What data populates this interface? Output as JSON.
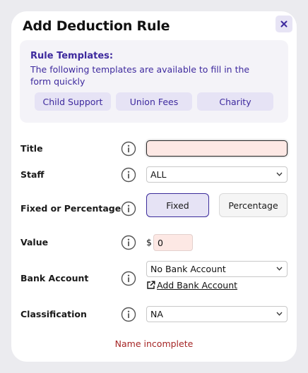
{
  "modal": {
    "title": "Add Deduction Rule",
    "close_icon": "close-icon"
  },
  "templates": {
    "heading": "Rule Templates:",
    "description": "The following templates are available to fill in the form quickly",
    "buttons": [
      "Child Support",
      "Union Fees",
      "Charity"
    ]
  },
  "form": {
    "title": {
      "label": "Title",
      "value": ""
    },
    "staff": {
      "label": "Staff",
      "selected": "ALL"
    },
    "type": {
      "label": "Fixed or Percentage",
      "options": [
        "Fixed",
        "Percentage"
      ],
      "selected": "Fixed"
    },
    "value": {
      "label": "Value",
      "currency": "$",
      "amount": "0"
    },
    "bank_account": {
      "label": "Bank Account",
      "selected": "No Bank Account",
      "add_link": "Add Bank Account"
    },
    "classification": {
      "label": "Classification",
      "selected": "NA"
    }
  },
  "error": "Name incomplete",
  "colors": {
    "accent": "#3e2a9e",
    "error": "#a52525",
    "invalid_field_bg": "#fde8e4"
  }
}
